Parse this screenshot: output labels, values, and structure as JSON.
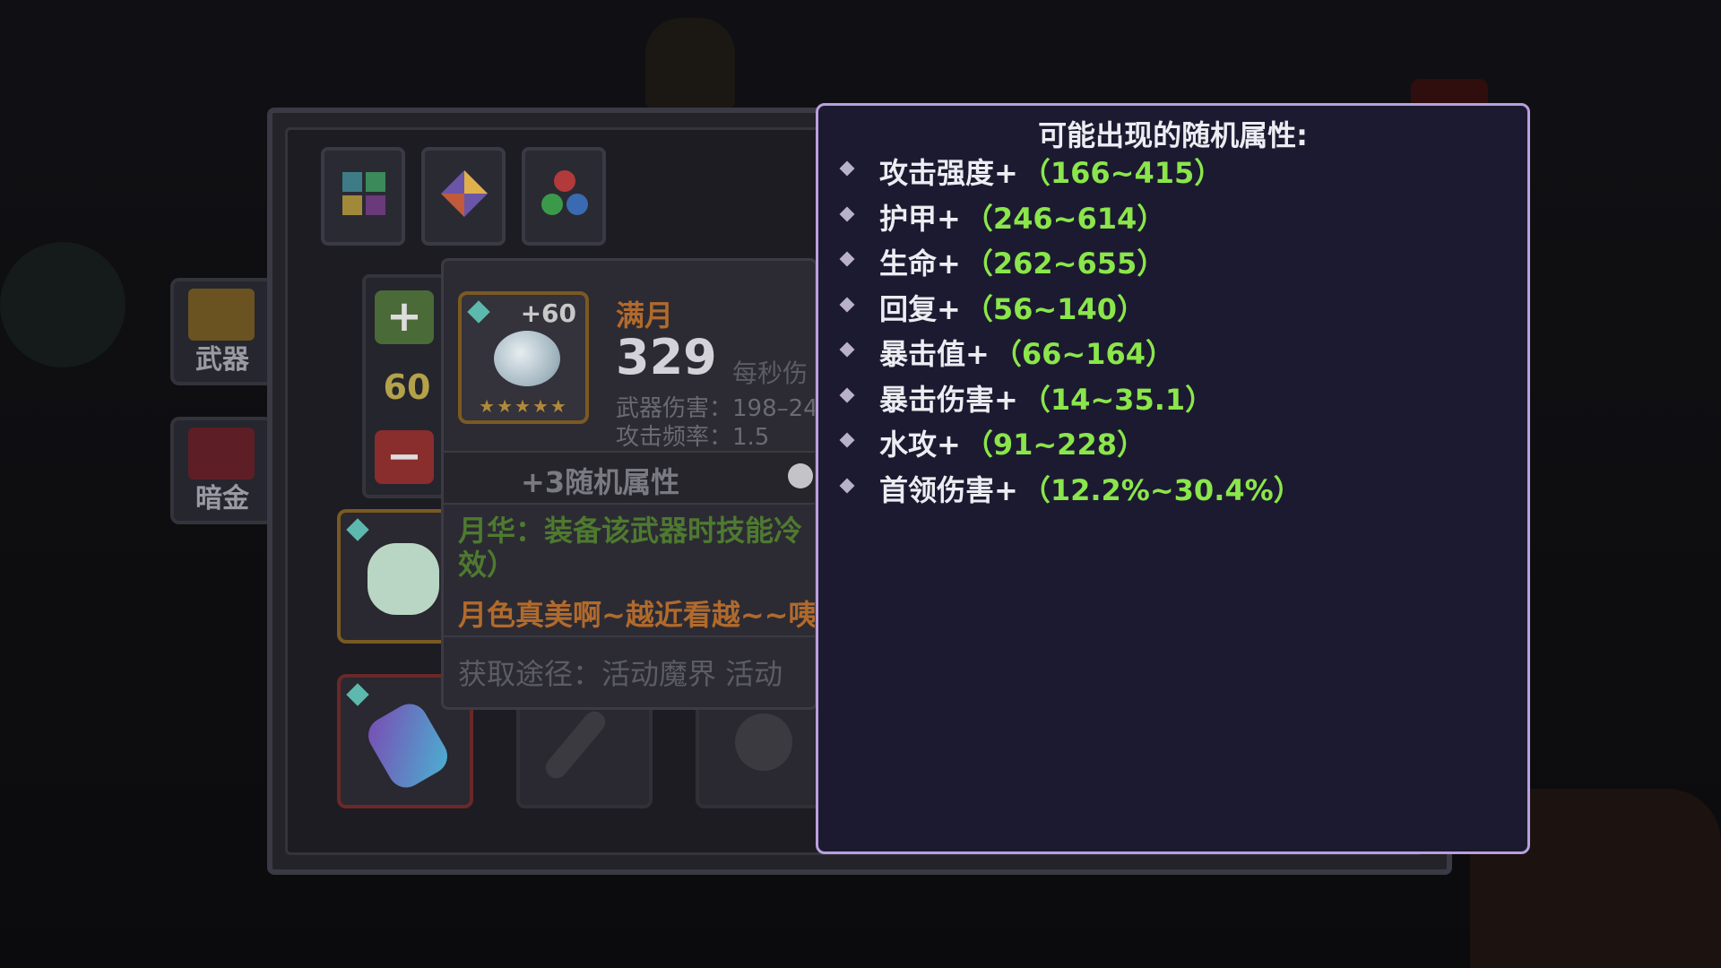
{
  "side_tabs": [
    {
      "label": "武器",
      "icon": "sword-chest-icon"
    },
    {
      "label": "暗金",
      "icon": "dark-gold-chest-icon"
    }
  ],
  "category_buttons": [
    {
      "icon": "grid-icon"
    },
    {
      "icon": "diamond-icon"
    },
    {
      "icon": "orbs-icon"
    }
  ],
  "stepper": {
    "plus_label": "+",
    "value": "60",
    "minus_label": "−"
  },
  "weapon": {
    "icon": "full-moon-weapon-icon",
    "enhance": "+60",
    "name": "满月",
    "power": "329",
    "power_label": "每秒伤",
    "stat_damage": "武器伤害：198–24",
    "stat_rate": "攻击频率：1.5",
    "random_attr_label": "+3随机属性",
    "skill_text": "月华：装备该武器时技能冷",
    "skill_text_2": "效）",
    "flavor_text": "月色真美啊~越近看越~~咦",
    "source_text": "获取途径：活动魔界  活动"
  },
  "popup": {
    "title": "可能出现的随机属性:",
    "attributes": [
      {
        "name": "攻击强度+",
        "range": "（166~415）"
      },
      {
        "name": "护甲+",
        "range": "（246~614）"
      },
      {
        "name": "生命+",
        "range": "（262~655）"
      },
      {
        "name": "回复+",
        "range": "（56~140）"
      },
      {
        "name": "暴击值+",
        "range": "（66~164）"
      },
      {
        "name": "暴击伤害+",
        "range": "（14~35.1）"
      },
      {
        "name": "水攻+",
        "range": "（91~228）"
      },
      {
        "name": "首领伤害+",
        "range": "（12.2%~30.4%）"
      }
    ]
  },
  "slots": [
    {
      "icon": "dragon-pet-icon"
    },
    {
      "icon": "rocket-weapon-icon"
    },
    {
      "icon": "feather-weapon-icon"
    },
    {
      "icon": "gear-orb-icon"
    }
  ],
  "colors": {
    "popup_bg": "#1c1a30",
    "popup_border": "#b9a0de",
    "range_green": "#8ae64a",
    "weapon_name_orange": "#b16a2c"
  }
}
